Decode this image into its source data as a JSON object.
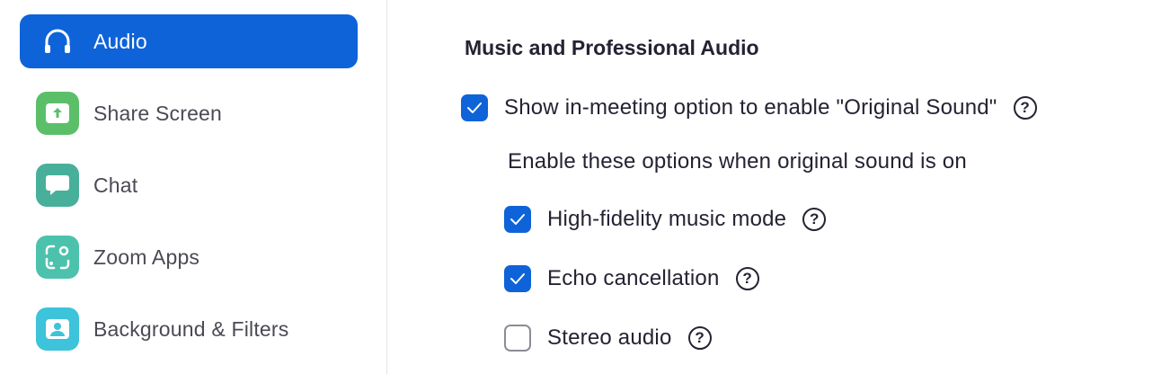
{
  "sidebar": {
    "items": [
      {
        "label": "Audio",
        "icon": "headphones-icon",
        "active": true
      },
      {
        "label": "Share Screen",
        "icon": "share-screen-icon",
        "color": "#5bbf6a"
      },
      {
        "label": "Chat",
        "icon": "chat-bubble-icon",
        "color": "#48b09a"
      },
      {
        "label": "Zoom Apps",
        "icon": "zoom-apps-icon",
        "color": "#4cc2ad"
      },
      {
        "label": "Background & Filters",
        "icon": "person-portrait-icon",
        "color": "#3dc3da"
      }
    ],
    "active_color": "#0e63d9"
  },
  "main": {
    "section_title": "Music and Professional Audio",
    "original_sound": {
      "label": "Show in-meeting option to enable \"Original Sound\"",
      "checked": true
    },
    "subtext": "Enable these options when original sound is on",
    "options": [
      {
        "label": "High-fidelity music mode",
        "checked": true
      },
      {
        "label": "Echo cancellation",
        "checked": true
      },
      {
        "label": "Stereo audio",
        "checked": false
      }
    ],
    "help_glyph": "?"
  }
}
